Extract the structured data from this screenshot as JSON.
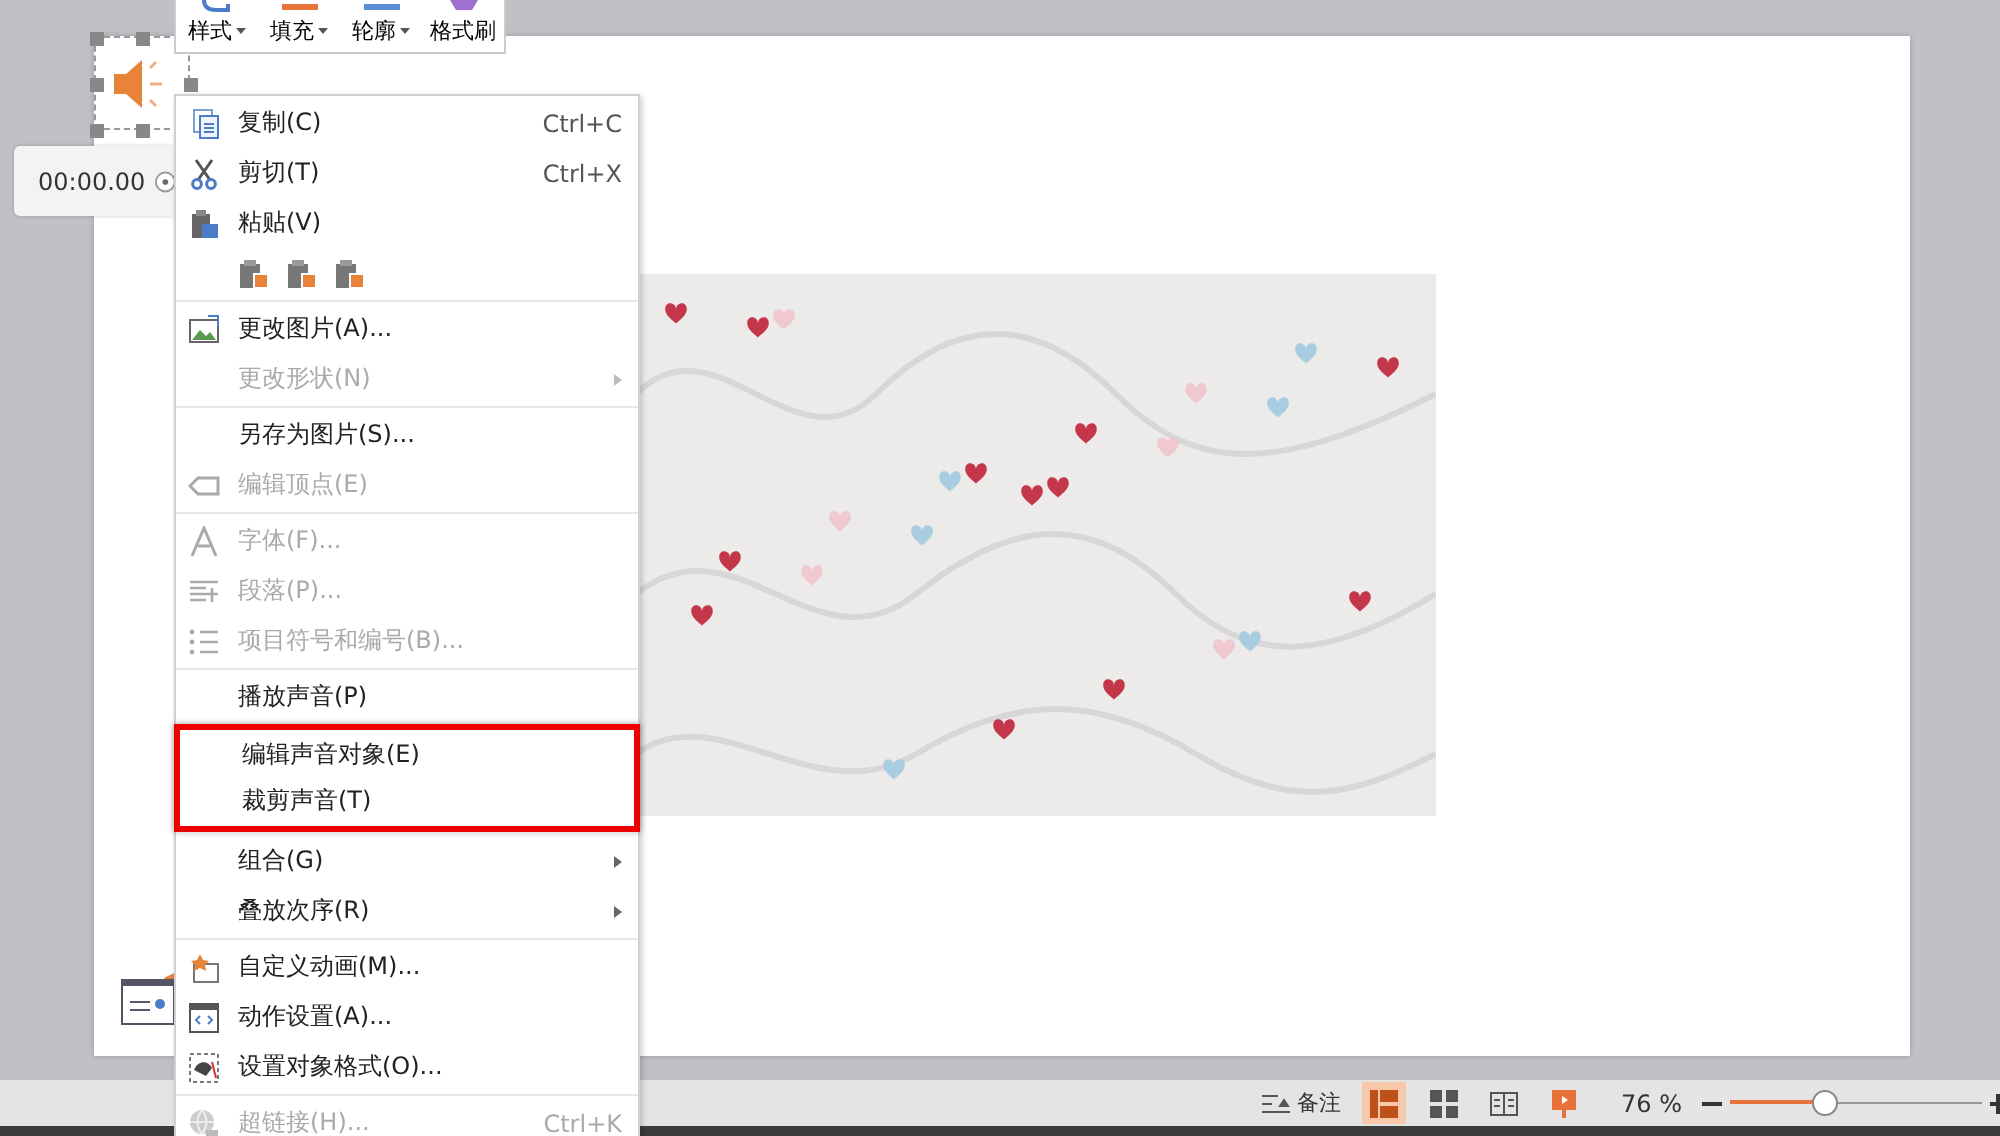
{
  "mini_toolbar": {
    "buttons": [
      {
        "label": "样式",
        "dropdown": true
      },
      {
        "label": "填充",
        "dropdown": true
      },
      {
        "label": "轮廓",
        "dropdown": true
      },
      {
        "label": "格式刷",
        "dropdown": false
      }
    ]
  },
  "audio_player": {
    "time": "00:00.00"
  },
  "context_menu": {
    "sections": [
      {
        "outlined": false,
        "items": [
          {
            "label": "复制(C)",
            "shortcut": "Ctrl+C",
            "disabled": false,
            "submenu": false
          },
          {
            "label": "剪切(T)",
            "shortcut": "Ctrl+X",
            "disabled": false,
            "submenu": false
          },
          {
            "label": "粘贴(V)",
            "disabled": false,
            "submenu": false
          },
          {
            "kind": "paste-options"
          }
        ]
      },
      {
        "outlined": false,
        "items": [
          {
            "label": "更改图片(A)...",
            "disabled": false,
            "submenu": false
          },
          {
            "label": "更改形状(N)",
            "disabled": true,
            "submenu": true
          }
        ]
      },
      {
        "outlined": false,
        "items": [
          {
            "label": "另存为图片(S)...",
            "disabled": false,
            "submenu": false
          },
          {
            "label": "编辑顶点(E)",
            "disabled": true,
            "submenu": false
          }
        ]
      },
      {
        "outlined": false,
        "items": [
          {
            "label": "字体(F)...",
            "disabled": true,
            "submenu": false
          },
          {
            "label": "段落(P)...",
            "disabled": true,
            "submenu": false
          },
          {
            "label": "项目符号和编号(B)...",
            "disabled": true,
            "submenu": false
          }
        ]
      },
      {
        "outlined": false,
        "items": [
          {
            "label": "播放声音(P)",
            "disabled": false,
            "submenu": false
          }
        ]
      },
      {
        "outlined": true,
        "items": [
          {
            "label": "编辑声音对象(E)",
            "disabled": false,
            "submenu": false
          },
          {
            "label": "裁剪声音(T)",
            "disabled": false,
            "submenu": false
          }
        ]
      },
      {
        "outlined": false,
        "items": [
          {
            "label": "组合(G)",
            "disabled": false,
            "submenu": true
          },
          {
            "label": "叠放次序(R)",
            "disabled": false,
            "submenu": true
          }
        ]
      },
      {
        "outlined": false,
        "items": [
          {
            "label": "自定义动画(M)...",
            "disabled": false,
            "submenu": false
          },
          {
            "label": "动作设置(A)...",
            "disabled": false,
            "submenu": false
          },
          {
            "label": "设置对象格式(O)...",
            "disabled": false,
            "submenu": false
          }
        ]
      },
      {
        "outlined": false,
        "items": [
          {
            "label": "超链接(H)...",
            "shortcut": "Ctrl+K",
            "disabled": true,
            "submenu": false
          }
        ]
      }
    ]
  },
  "status_bar": {
    "notes": "备注",
    "views": [
      {
        "selected": true
      },
      {
        "selected": false
      },
      {
        "selected": false
      },
      {
        "selected": false
      }
    ],
    "zoom": "76 %",
    "zoom_slider": {
      "level": 0.37
    }
  }
}
